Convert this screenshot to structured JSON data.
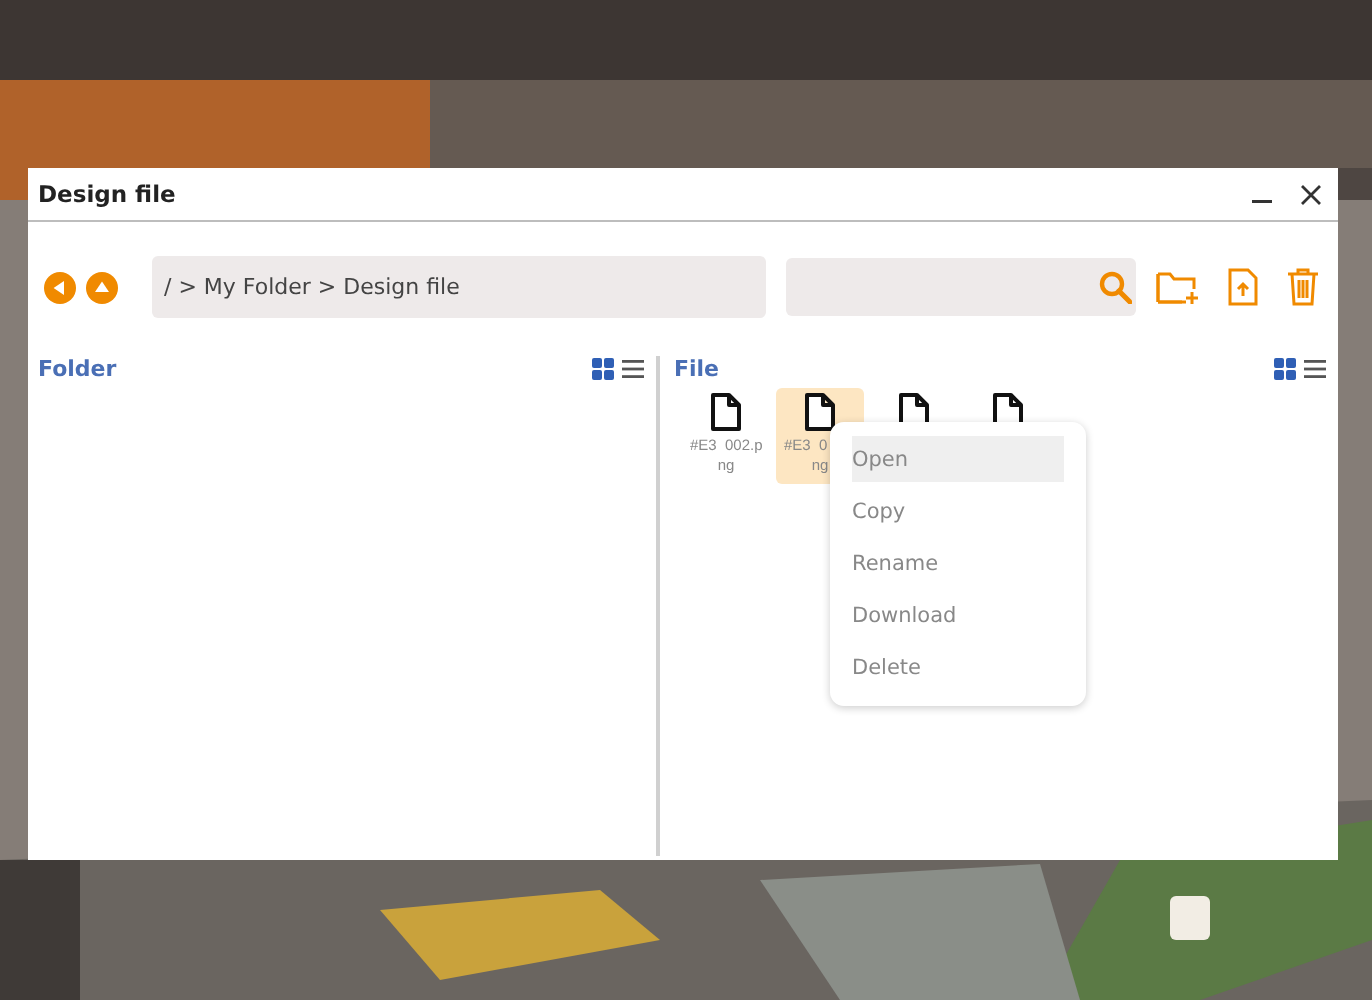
{
  "window": {
    "title": "Design file"
  },
  "toolbar": {
    "path": "/ > My Folder > Design file"
  },
  "folder_panel": {
    "title": "Folder",
    "grid_view": true
  },
  "file_panel": {
    "title": "File",
    "grid_view": true,
    "files": [
      {
        "label_lines": [
          "#E3  002.p",
          "ng"
        ],
        "selected": false
      },
      {
        "label_lines": [
          "#E3  0",
          "ng"
        ],
        "selected": true
      },
      {
        "selected": false
      },
      {
        "selected": false
      }
    ]
  },
  "context_menu": {
    "items": [
      {
        "label": "Open",
        "selected": true
      },
      {
        "label": "Copy",
        "selected": false
      },
      {
        "label": "Rename",
        "selected": false
      },
      {
        "label": "Download",
        "selected": false
      },
      {
        "label": "Delete",
        "selected": false
      }
    ]
  }
}
